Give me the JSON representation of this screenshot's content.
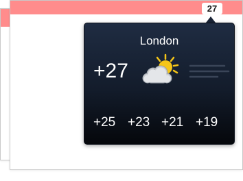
{
  "badge": {
    "count": "27"
  },
  "weather": {
    "city": "London",
    "current_temp": "+27",
    "condition_icon": "partly-sunny-icon",
    "forecast": [
      "+25",
      "+23",
      "+21",
      "+19"
    ]
  },
  "colors": {
    "title_bar": "#ff8c8c",
    "popup_top": "#1f2c42",
    "popup_bottom": "#05070b",
    "sun": "#f5c518"
  }
}
